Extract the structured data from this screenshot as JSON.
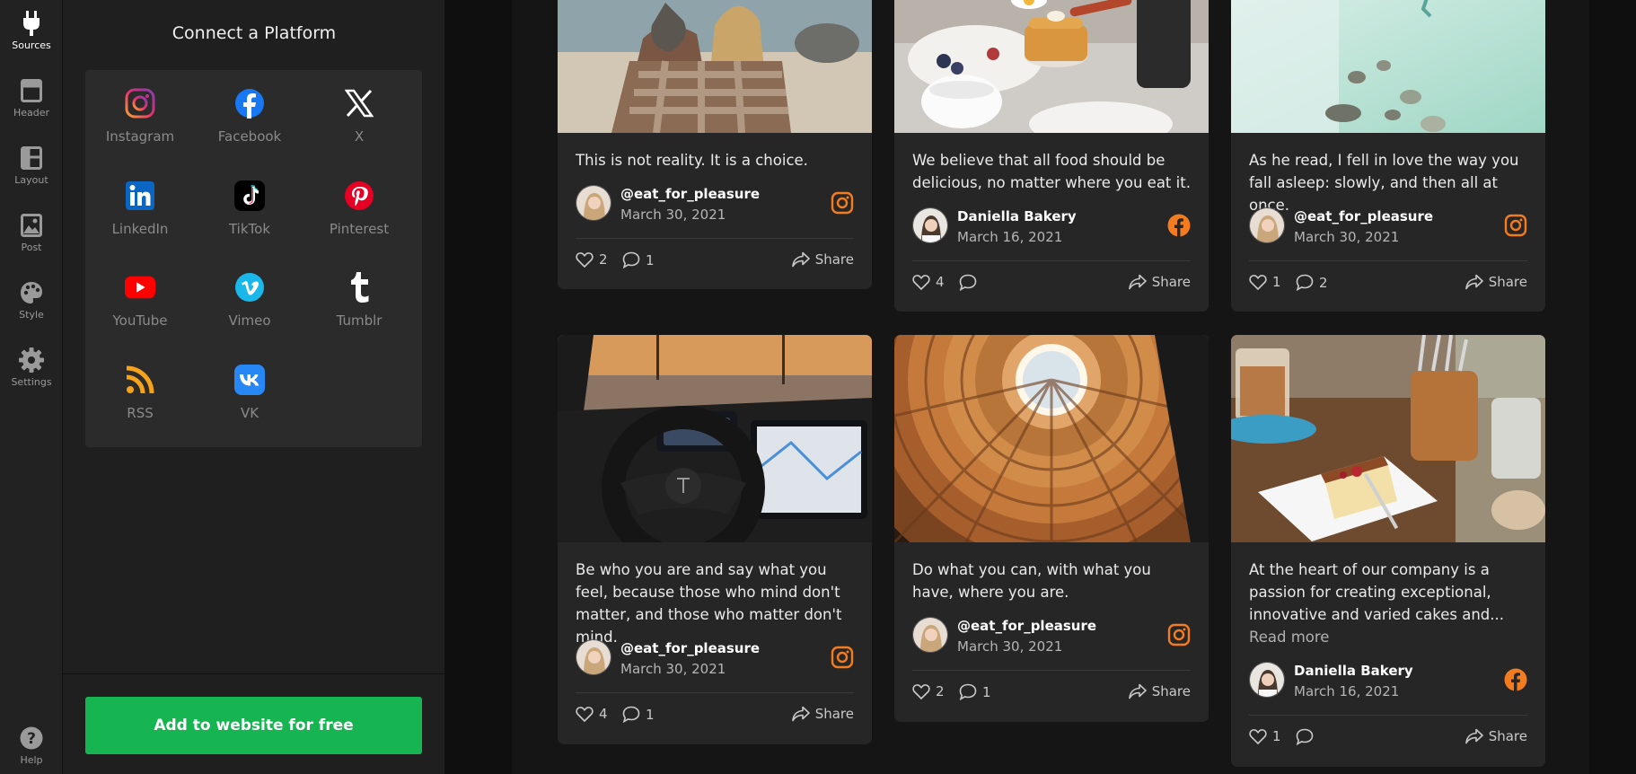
{
  "rail": {
    "items": [
      {
        "label": "Sources",
        "icon": "plug-icon",
        "active": true
      },
      {
        "label": "Header",
        "icon": "header-icon",
        "active": false
      },
      {
        "label": "Layout",
        "icon": "layout-icon",
        "active": false
      },
      {
        "label": "Post",
        "icon": "image-icon",
        "active": false
      },
      {
        "label": "Style",
        "icon": "palette-icon",
        "active": false
      },
      {
        "label": "Settings",
        "icon": "gear-icon",
        "active": false
      }
    ],
    "help_label": "Help"
  },
  "panel": {
    "title": "Connect a Platform",
    "platforms": [
      {
        "label": "Instagram",
        "icon": "instagram-icon",
        "color": "#e1306c"
      },
      {
        "label": "Facebook",
        "icon": "facebook-icon",
        "color": "#1877f2"
      },
      {
        "label": "X",
        "icon": "x-icon",
        "color": "#ffffff"
      },
      {
        "label": "LinkedIn",
        "icon": "linkedin-icon",
        "color": "#0a66c2"
      },
      {
        "label": "TikTok",
        "icon": "tiktok-icon",
        "color": "#000000"
      },
      {
        "label": "Pinterest",
        "icon": "pinterest-icon",
        "color": "#e60023"
      },
      {
        "label": "YouTube",
        "icon": "youtube-icon",
        "color": "#ff0000"
      },
      {
        "label": "Vimeo",
        "icon": "vimeo-icon",
        "color": "#1ab7ea"
      },
      {
        "label": "Tumblr",
        "icon": "tumblr-icon",
        "color": "#ffffff"
      },
      {
        "label": "RSS",
        "icon": "rss-icon",
        "color": "#f7a21b"
      },
      {
        "label": "VK",
        "icon": "vk-icon",
        "color": "#2787f5"
      }
    ],
    "cta_label": "Add to website for free",
    "cta_color": "#17b552"
  },
  "accent_color": "#f47c20",
  "posts": [
    {
      "text": "This is not reality. It is a choice.",
      "author": "@eat_for_pleasure",
      "date": "March 30, 2021",
      "source": "instagram-icon",
      "likes": "2",
      "comments": "1",
      "share": "Share"
    },
    {
      "text": "We believe that all food should be delicious, no matter where you eat it.",
      "author": "Daniella Bakery",
      "date": "March 16, 2021",
      "source": "facebook-icon",
      "likes": "4",
      "comments": "",
      "share": "Share"
    },
    {
      "text": "As he read, I fell in love the way you fall asleep: slowly, and then all at once.",
      "author": "@eat_for_pleasure",
      "date": "March 30, 2021",
      "source": "instagram-icon",
      "likes": "1",
      "comments": "2",
      "share": "Share"
    },
    {
      "text": "Be who you are and say what you feel, because those who mind don't matter, and those who matter don't mind.",
      "author": "@eat_for_pleasure",
      "date": "March 30, 2021",
      "source": "instagram-icon",
      "likes": "4",
      "comments": "1",
      "share": "Share"
    },
    {
      "text": "Do what you can, with what you have, where you are.",
      "author": "@eat_for_pleasure",
      "date": "March 30, 2021",
      "source": "instagram-icon",
      "likes": "2",
      "comments": "1",
      "share": "Share"
    },
    {
      "text": "At the heart of our company is a passion for creating exceptional, innovative and varied cakes and...",
      "read_more": "Read more",
      "author": "Daniella Bakery",
      "date": "March 16, 2021",
      "source": "facebook-icon",
      "likes": "1",
      "comments": "",
      "share": "Share"
    }
  ]
}
